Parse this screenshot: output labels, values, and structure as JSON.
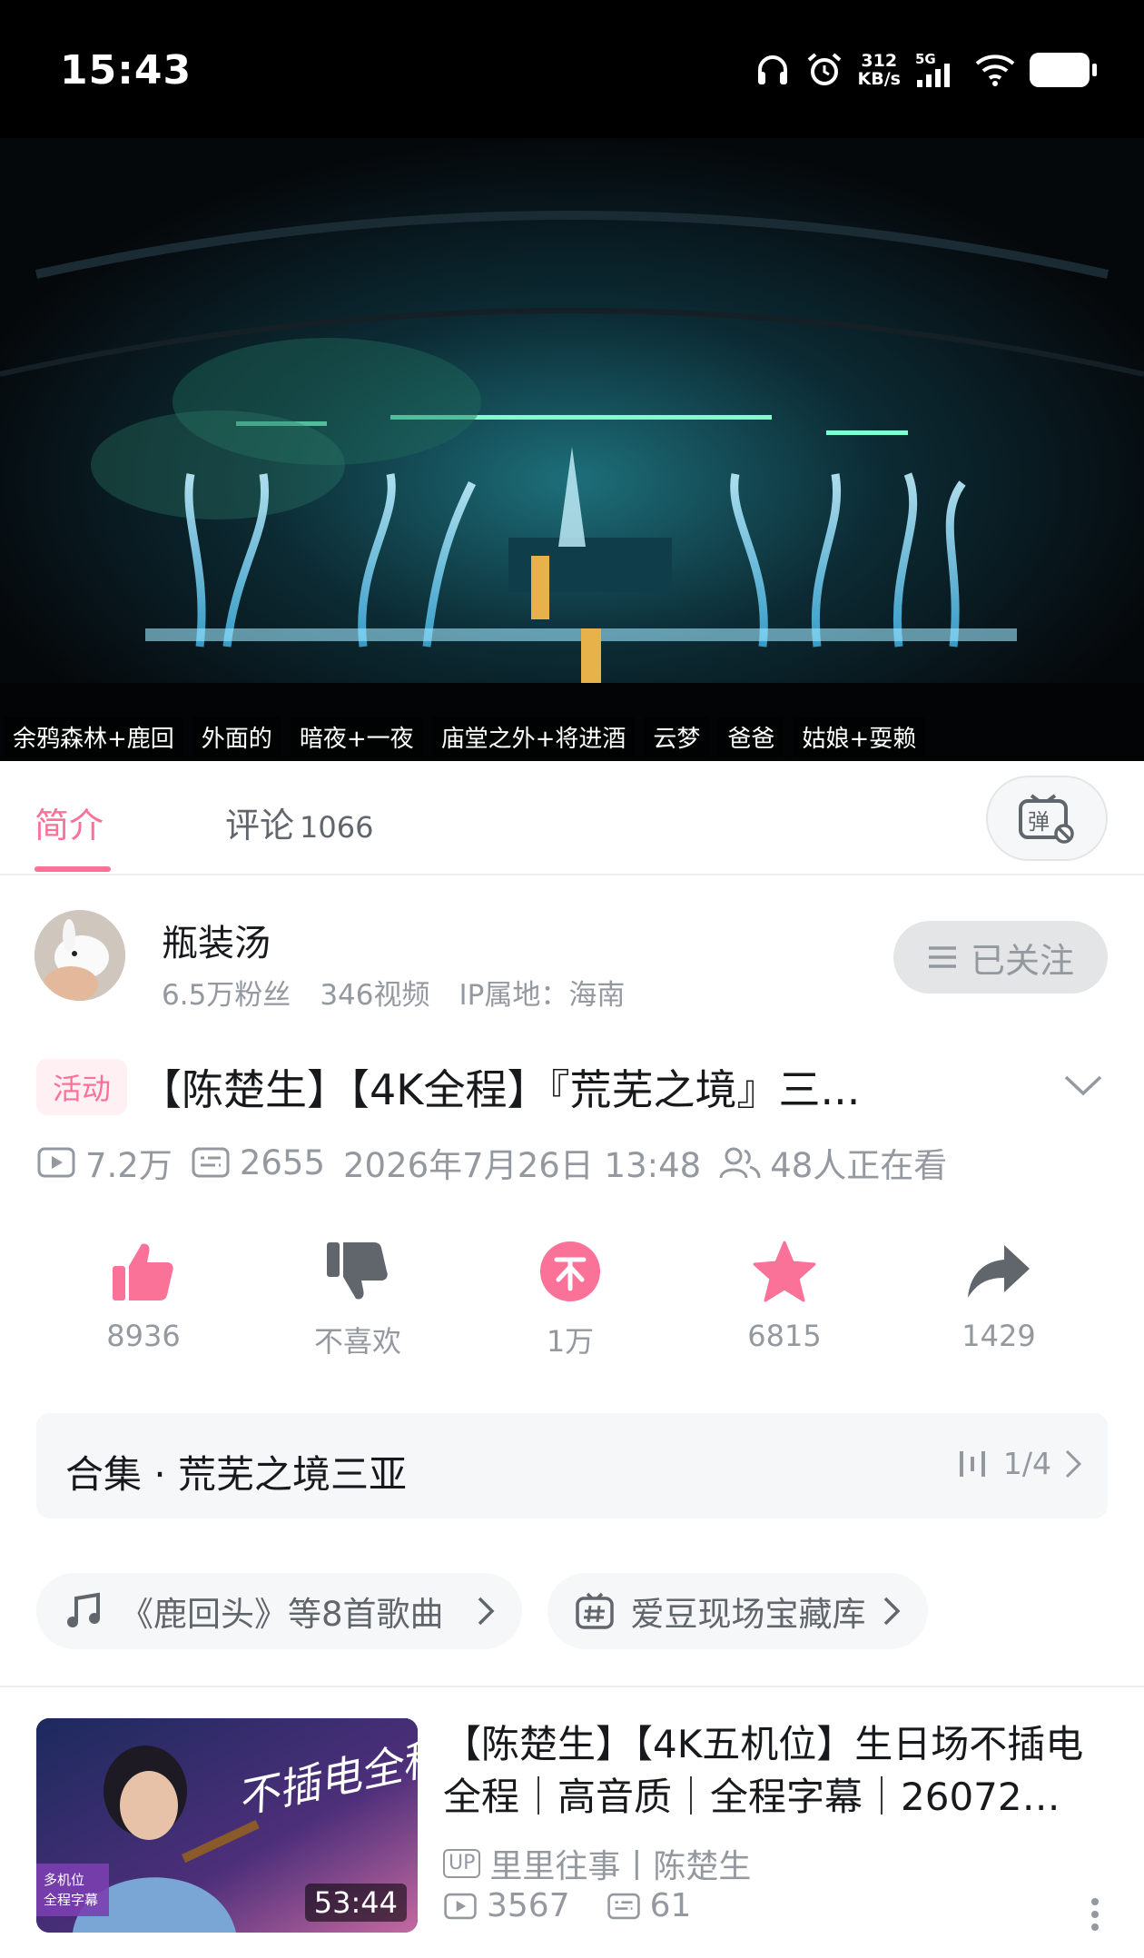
{
  "status_bar": {
    "time": "15:43",
    "net_speed_value": "312",
    "net_speed_unit": "KB/s",
    "network": "5G"
  },
  "video": {
    "chapters": [
      "余鸦森林+鹿回",
      "外面的",
      "暗夜+一夜",
      "庙堂之外+将进酒",
      "云梦",
      "爸爸",
      "姑娘+耍赖"
    ]
  },
  "tabs": {
    "intro": "简介",
    "comments": "评论",
    "comments_count": "1066",
    "danmaku_icon": "danmaku-toggle-icon"
  },
  "author": {
    "name": "瓶装汤",
    "fans": "6.5万粉丝",
    "videos": "346视频",
    "ip": "IP属地：海南",
    "follow_label": "已关注"
  },
  "video_info": {
    "badge": "活动",
    "title": "【陈楚生】【4K全程】『荒芜之境』三...",
    "views": "7.2万",
    "danmaku": "2655",
    "datetime": "2026年7月26日 13:48",
    "watching": "48人正在看"
  },
  "actions": [
    {
      "icon": "thumbs-up-icon",
      "label": "8936",
      "color": "#fb7299"
    },
    {
      "icon": "thumbs-down-icon",
      "label": "不喜欢",
      "color": "#61666d"
    },
    {
      "icon": "coin-icon",
      "label": "1万",
      "color": "#fb7299"
    },
    {
      "icon": "star-icon",
      "label": "6815",
      "color": "#fb7299"
    },
    {
      "icon": "share-icon",
      "label": "1429",
      "color": "#61666d"
    }
  ],
  "collection": {
    "title": "合集 · 荒芜之境三亚",
    "progress": "1/4"
  },
  "chips": [
    {
      "icon": "music-note-icon",
      "label": "《鹿回头》等8首歌曲"
    },
    {
      "icon": "hashtag-tv-icon",
      "label": "爱豆现场宝藏库"
    }
  ],
  "recommend": {
    "title_line1": "【陈楚生】【4K五机位】生日场不插电",
    "title_line2": "全程｜高音质｜全程字幕｜26072…",
    "up_tag": "UP",
    "uploader": "里里往事丨陈楚生",
    "views": "3567",
    "danmaku": "61",
    "duration": "53:44",
    "thumb_tag_line1": "多机位",
    "thumb_tag_line2": "全程字幕",
    "thumb_script": "不插电全程"
  },
  "colors": {
    "accent": "#fb7299",
    "text": "#18191c",
    "secondary": "#9499a0"
  }
}
